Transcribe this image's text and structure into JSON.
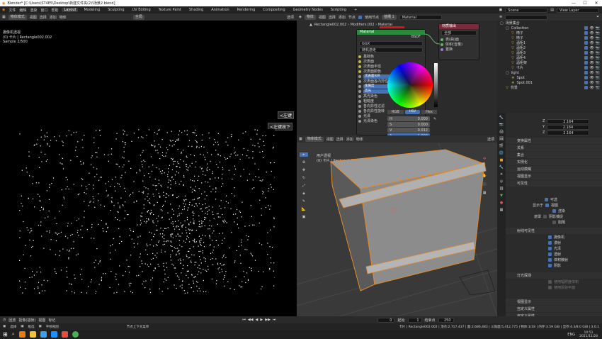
{
  "window": {
    "title": "Blender* [C:\\Users\\ST4E5\\Desktop\\新建文件夹(2)\\场景2.blend]",
    "controls": [
      "—",
      "☐",
      "✕"
    ]
  },
  "menu": {
    "items": [
      "文件",
      "编辑",
      "渲染",
      "窗口",
      "帮助"
    ],
    "workspaces": [
      "Layout",
      "Modeling",
      "Sculpting",
      "UV Editing",
      "Texture Paint",
      "Shading",
      "Animation",
      "Rendering",
      "Compositing",
      "Geometry Nodes",
      "Scripting",
      "+"
    ],
    "active_workspace": "Layout",
    "scene": "Scene",
    "view_layer": "View Layer"
  },
  "render_view": {
    "header": [
      "物体模式",
      "视图",
      "选择",
      "添加",
      "物体"
    ],
    "mode": "全局",
    "info_line1": "摄像机透视",
    "info_line2": "(0) 卡片 | Rectangle002.002",
    "info_line3": "Sample 2/500",
    "label_left": "<左键",
    "label_right": "<左键按下",
    "options": "选项"
  },
  "node_editor": {
    "header": [
      "物体",
      "视图",
      "选择",
      "添加",
      "节点"
    ],
    "use_nodes": "使用节点",
    "slot": "插槽 1",
    "material": "Material",
    "breadcrumb": "Rectangle002.002 › Modifiers.002 › Material",
    "node_title": "Material",
    "bsdf": "BSDF",
    "dist": "GGX",
    "sss": "随机游走",
    "inputs": [
      "基础色",
      "次表面",
      "次表面半径",
      "次表面颜色",
      "次表面IOR",
      "次表面各向异性",
      "金属度",
      "高光",
      "高光染色",
      "粗糙度",
      "各向异性过滤",
      "各向异性旋转",
      "光泽",
      "光泽染色"
    ],
    "blue_fields": {
      "sss_ior": "次表面IOR",
      "metal": "金属度",
      "spec": "高光"
    },
    "color_tabs": [
      "RGB",
      "HSV",
      "Hex"
    ],
    "active_color_tab": "HSV",
    "hsv": [
      {
        "k": "H",
        "v": "0.000"
      },
      {
        "k": "S",
        "v": "0.000"
      },
      {
        "k": "V",
        "v": "0.012"
      },
      {
        "k": "A",
        "v": "1.000"
      }
    ],
    "output_node": {
      "title": "材质输出",
      "target": "全部",
      "sockets": [
        "表(曲)面",
        "体积(音量)",
        "置换"
      ]
    }
  },
  "viewport3d": {
    "header": [
      "物体模式",
      "视图",
      "选择",
      "添加",
      "物体"
    ],
    "info1": "用户透视",
    "info2": "(0) 卡片 | Rectangle002.002",
    "options": "选项"
  },
  "outliner": {
    "search": "",
    "title": "场景集合",
    "items": [
      {
        "name": "Collection",
        "indent": 1
      },
      {
        "name": "椅子",
        "indent": 2
      },
      {
        "name": "椅子",
        "indent": 2
      },
      {
        "name": "酒柜1",
        "indent": 2
      },
      {
        "name": "酒柜2",
        "indent": 2
      },
      {
        "name": "酒柜3",
        "indent": 2
      },
      {
        "name": "酒柜4",
        "indent": 2
      },
      {
        "name": "酒柜架",
        "indent": 2
      },
      {
        "name": "卡片",
        "indent": 2
      },
      {
        "name": "light",
        "indent": 1
      },
      {
        "name": "Spot",
        "indent": 2
      },
      {
        "name": "Spot.001",
        "indent": 2
      },
      {
        "name": "背景",
        "indent": 1
      }
    ]
  },
  "properties": {
    "xyz": [
      {
        "k": "Z",
        "v": "2.164"
      },
      {
        "k": "Y",
        "v": "2.164"
      },
      {
        "k": "Z",
        "v": "2.164"
      }
    ],
    "sections": [
      "变换属性",
      "关系",
      "集合",
      "实例化",
      "运动模糊",
      "视图显示",
      "可见性"
    ],
    "visibility": {
      "selectable": "可选",
      "show_in": "显示于",
      "viewports": "视图",
      "renders": "渲染",
      "mask": "遮罩",
      "holdout": "阻隔",
      "shadow_catcher": "阴影捕捉"
    },
    "ray_visibility": "射线可见性",
    "rays": [
      "摄像机",
      "漫射",
      "光泽",
      "透射",
      "体积散射",
      "阴影"
    ],
    "light_probes": "灯光探测",
    "probe_items": [
      "使用辐照度体积",
      "使用反射平面"
    ],
    "more": [
      "视图显示",
      "自定义属性",
      "自定义属性"
    ]
  },
  "timeline": {
    "labels": [
      "回放",
      "抠像(插帧)",
      "视图",
      "标记"
    ],
    "frame": "0",
    "start_label": "起始",
    "start": "1",
    "end_label": "结束点",
    "end": "250"
  },
  "status": {
    "left": [
      "选择",
      "框选",
      "平移视图"
    ],
    "mid": "节点上下文菜单",
    "right": "卡片 | Rectangle002.002 | 顶点:2,717,437 | 面:2,686,483 | 三角面:5,412,775 | 物体:1/18 | 内存:3.59 GiB | 显存:4.3/8.0 GiB | 3.0.1"
  },
  "taskbar": {
    "lang": "ENG",
    "time": "10:51",
    "date": "2021/11/28"
  }
}
